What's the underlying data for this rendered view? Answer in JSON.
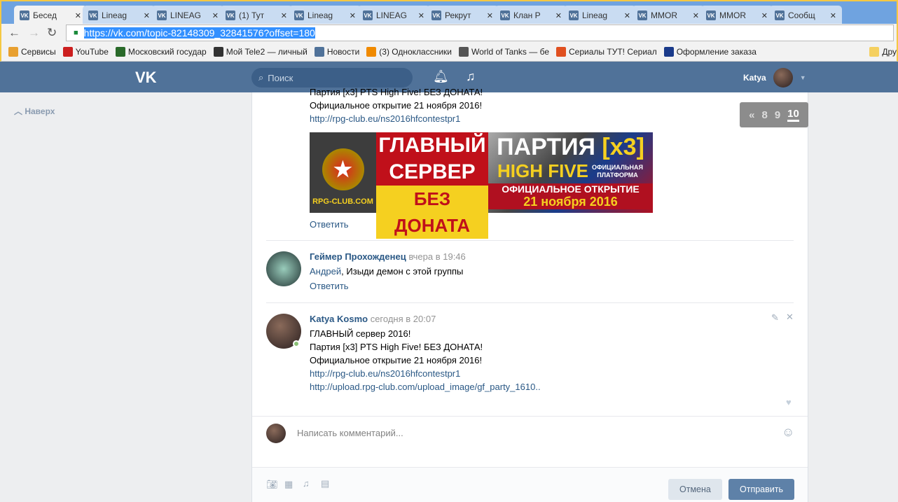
{
  "browser": {
    "tabs": [
      "Бесед",
      "Lineag",
      "LINEAG",
      "(1) Тут",
      "Lineag",
      "LINEAG",
      "Рекрут",
      "Клан Р",
      "Lineag",
      "MMOR",
      "MMOR",
      "Сообщ"
    ],
    "url": "https://vk.com/topic-82148309_32841576?offset=180",
    "bookmarks": [
      "Сервисы",
      "YouTube",
      "Московский государ",
      "Мой Tele2 — личный",
      "Новости",
      "(3) Одноклассники",
      "World of Tanks — бе",
      "Сериалы ТУТ! Сериал",
      "Оформление заказа",
      "Дру"
    ]
  },
  "header": {
    "logo": "VK",
    "search_placeholder": "Поиск",
    "user": "Katya"
  },
  "sidebar": {
    "up": "Наверх"
  },
  "pagination": {
    "prev": "«",
    "pages": [
      "8",
      "9",
      "10"
    ],
    "current": "10"
  },
  "posts": [
    {
      "lines": [
        "Партия [x3] PTS High Five! БЕЗ ДОНАТА!",
        "Официальное открытие 21 ноября 2016!"
      ],
      "link": "http://rpg-club.eu/ns2016hfcontestpr1",
      "banner": {
        "logo": "RPG-CLUB.COM",
        "a1": "ГЛАВНЫЙ",
        "a2": "СЕРВЕР",
        "a3": "БЕЗ ДОНАТА",
        "b1": "ПАРТИЯ",
        "b1x": "[x3]",
        "b2": "HIGH FIVE",
        "b2s": "ОФИЦИАЛЬНАЯ ПЛАТФОРМА",
        "b3": "ОФИЦИАЛЬНОЕ ОТКРЫТИЕ",
        "b4": "21 ноября 2016"
      },
      "reply": "Ответить"
    },
    {
      "author": "Геймер Прохожденец",
      "time": "вчера в 19:46",
      "mention": "Андрей",
      "text": ", Изыди демон с этой группы",
      "reply": "Ответить"
    },
    {
      "author": "Katya Kosmo",
      "time": "сегодня в 20:07",
      "lines": [
        "ГЛАВНЫЙ сервер 2016!",
        "Партия [x3] PTS High Five! БЕЗ ДОНАТА!",
        "Официальное открытие 21 ноября 2016!"
      ],
      "links": [
        "http://rpg-club.eu/ns2016hfcontestpr1",
        "http://upload.rpg-club.com/upload_image/gf_party_1610.."
      ]
    }
  ],
  "composer": {
    "placeholder": "Написать комментарий...",
    "cancel": "Отмена",
    "send": "Отправить"
  }
}
